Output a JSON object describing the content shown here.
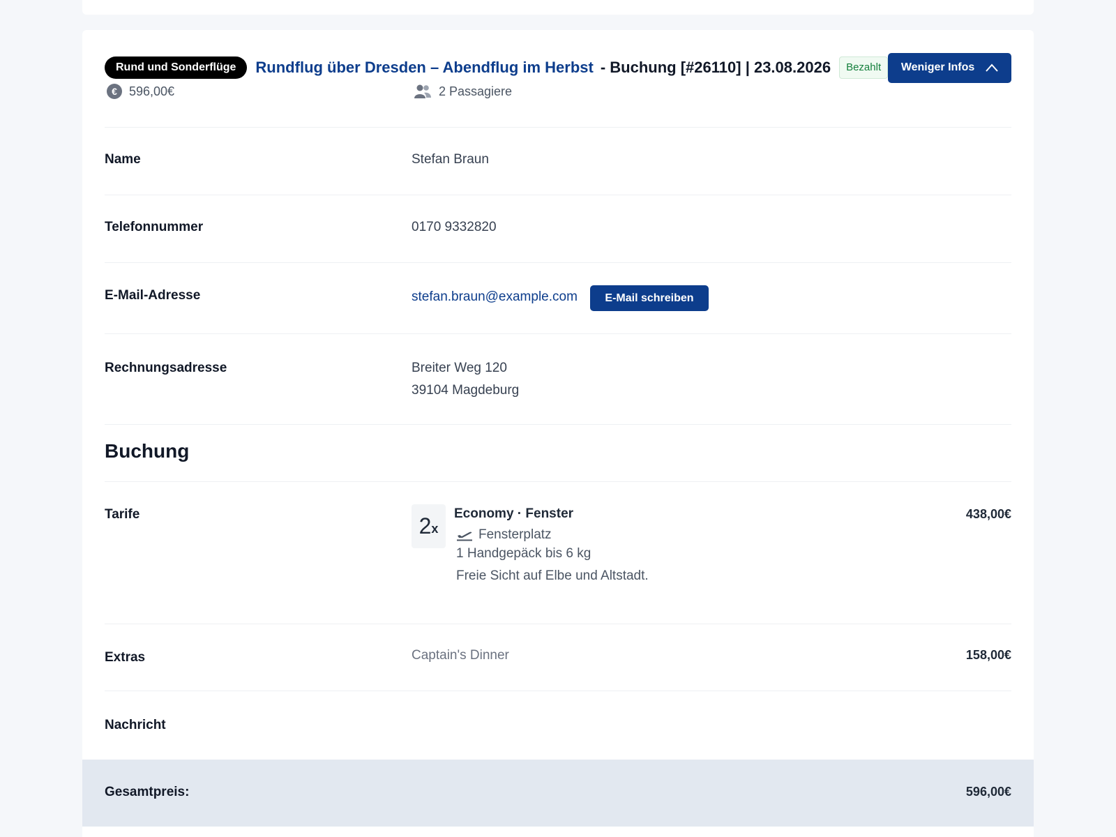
{
  "header": {
    "category": "Rund und Sonderflüge",
    "flight_title": "Rundflug über Dresden – Abendflug im Herbst",
    "booking_info": "- Buchung [#26110] | 23.08.2026",
    "status": "Bezahlt",
    "toggle_label": "Weniger Infos",
    "price": "596,00€",
    "passengers": "2 Passagiere"
  },
  "customer": {
    "name_label": "Name",
    "name": "Stefan Braun",
    "phone_label": "Telefonnummer",
    "phone": "0170 9332820",
    "email_label": "E-Mail-Adresse",
    "email": "stefan.braun@example.com",
    "email_button": "E-Mail schreiben",
    "address_label": "Rechnungsadresse",
    "address_line1": "Breiter Weg 120",
    "address_line2": "39104 Magdeburg"
  },
  "booking": {
    "section_title": "Buchung",
    "tariffs_label": "Tarife",
    "tariff_qty": "2",
    "tariff_qty_suffix": "x",
    "tariff_name": "Economy · Fenster",
    "tariff_seat": "Fensterplatz",
    "tariff_baggage": "1 Handgepäck bis 6 kg",
    "tariff_description": "Freie Sicht auf Elbe und Altstadt.",
    "tariff_price": "438,00€",
    "extras_label": "Extras",
    "extras_value": "Captain's Dinner",
    "extras_price": "158,00€",
    "message_label": "Nachricht",
    "total_label": "Gesamtpreis:",
    "total_value": "596,00€"
  },
  "colors": {
    "primary": "#0d3d8c",
    "status_green": "#15803d",
    "total_bar": "#e2e8f0"
  }
}
